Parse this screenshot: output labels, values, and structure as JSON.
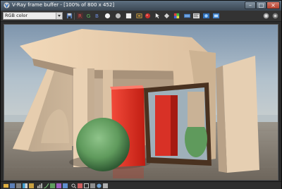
{
  "window": {
    "title": "V-Ray frame buffer - [100% of 800 x 452]"
  },
  "title_buttons": {
    "minimize_glyph": "–",
    "maximize_glyph": "□",
    "close_glyph": "×"
  },
  "toolbar": {
    "channel_value": "RGB color",
    "channel_letters": {
      "red": "R",
      "green": "G",
      "blue": "B"
    }
  },
  "colors": {
    "red_channel": "#e05050",
    "green_channel": "#5fbf5f",
    "blue_channel": "#6f8fe0",
    "render_red_box": "#e0291d",
    "render_green_sphere": "#5f9a5c",
    "render_frame": "#4a3220"
  },
  "icons": {
    "toolbar_left": [
      "save-image-icon",
      "red-channel-toggle",
      "green-channel-toggle",
      "blue-channel-toggle"
    ],
    "toolbar_middle": [
      "alpha-channel-icon",
      "monochrome-icon",
      "clear-image-icon",
      "region-render-icon",
      "render-icon",
      "track-mouse-icon",
      "color-corrections-icon",
      "srgb-icon",
      "pixel-info-icon",
      "lens-effects-icon"
    ],
    "toolbar_right": [
      "stop-render-icon",
      "settings-icon"
    ]
  }
}
